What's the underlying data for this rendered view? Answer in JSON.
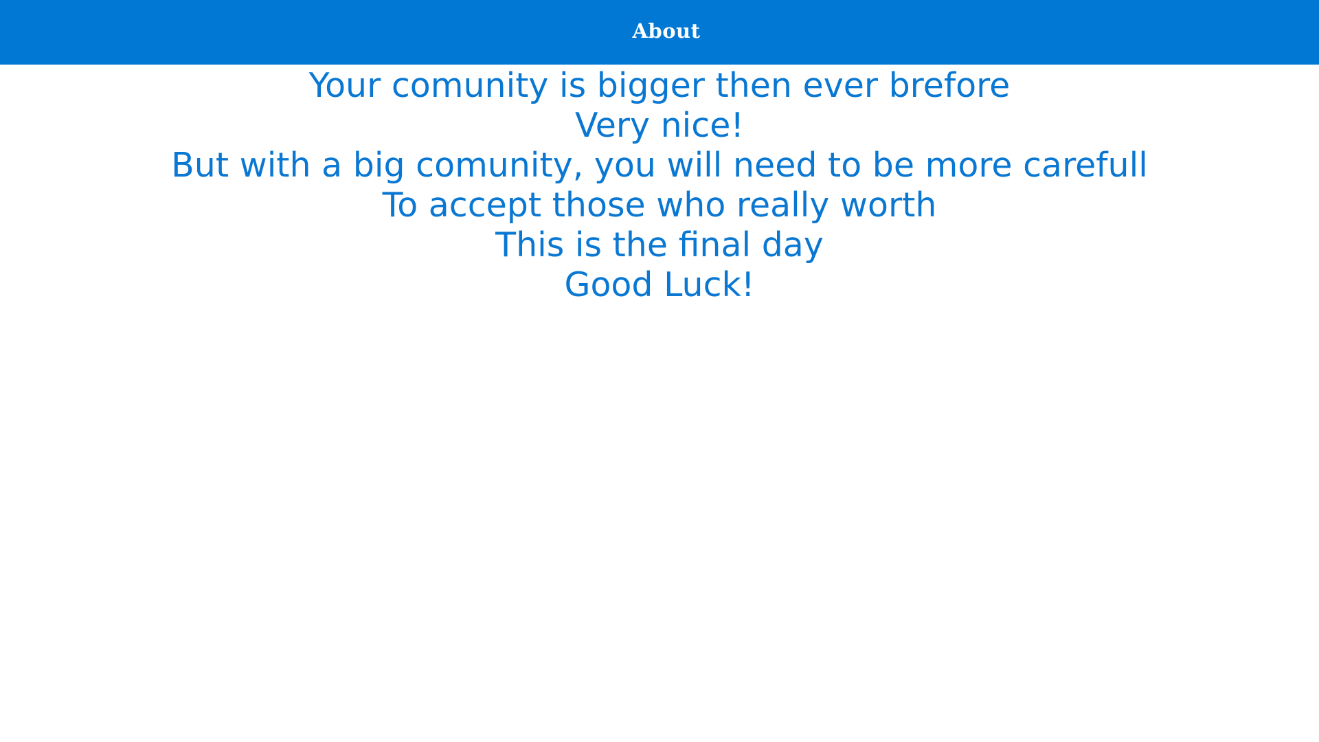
{
  "header": {
    "title": "About",
    "background_color": "#0078d4",
    "text_color": "#ffffff"
  },
  "message": {
    "text_color": "#0a78d2",
    "lines": [
      "Your comunity is bigger then ever brefore",
      "Very nice!",
      "But with a big comunity, you will need to be more carefull",
      "To accept those who really worth",
      "This is the final day",
      "Good Luck!"
    ]
  }
}
